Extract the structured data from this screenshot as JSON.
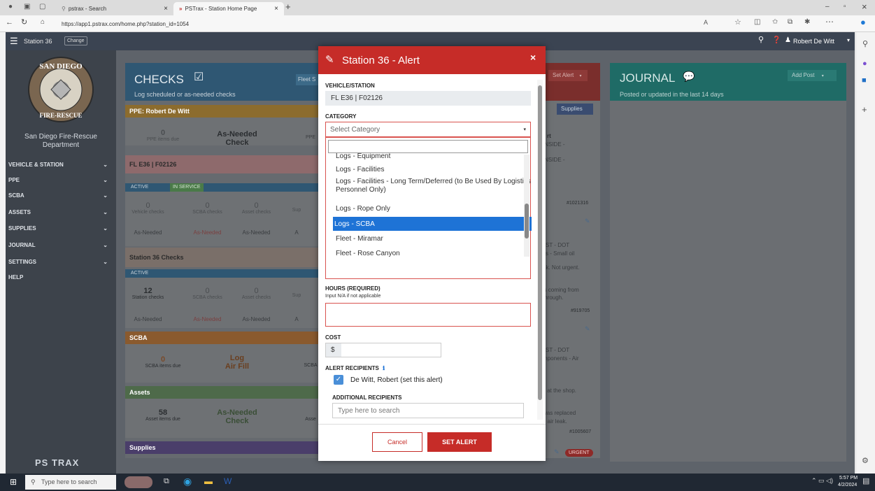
{
  "browser": {
    "tabs": [
      {
        "label": "pstrax - Search"
      },
      {
        "label": "PSTrax - Station Home Page"
      }
    ],
    "url": "https://app1.pstrax.com/home.php?station_id=1054",
    "close_glyph": "×",
    "newtab_glyph": "+"
  },
  "app": {
    "station": "Station 36",
    "change": "Change",
    "user": "Robert De Witt",
    "org_name": "San Diego Fire-Rescue Department",
    "brand": "PS TRAX",
    "seal_text_top": "SAN DIEGO",
    "seal_text_bottom": "FIRE-RESCUE",
    "sidebar": [
      {
        "label": "VEHICLE & STATION",
        "caret": "⌄"
      },
      {
        "label": "PPE",
        "caret": "⌄"
      },
      {
        "label": "SCBA",
        "caret": "⌄"
      },
      {
        "label": "ASSETS",
        "caret": "⌄"
      },
      {
        "label": "SUPPLIES",
        "caret": "⌄"
      },
      {
        "label": "JOURNAL",
        "caret": "⌄"
      },
      {
        "label": "SETTINGS",
        "caret": "⌄"
      },
      {
        "label": "HELP",
        "caret": ""
      }
    ]
  },
  "checks": {
    "title": "CHECKS",
    "subtitle": "Log scheduled or as-needed checks",
    "fleet_btn": "Fleet S",
    "ppe": {
      "header": "PPE: Robert De Witt",
      "count": "0",
      "count_label": "PPE items due",
      "action1": "As-Needed",
      "action2": "Check",
      "cut": "PPE"
    },
    "vehicle": {
      "header": "FL E36 | F02126",
      "badge_active": "ACTIVE",
      "badge_service": "IN SERVICE",
      "cols": [
        {
          "count": "0",
          "label": "Vehicle checks",
          "asneeded": "As-Needed"
        },
        {
          "count": "0",
          "label": "SCBA checks",
          "asneeded": "As-Needed"
        },
        {
          "count": "0",
          "label": "Asset checks",
          "asneeded": "As-Needed"
        },
        {
          "count": "",
          "label": "Sup",
          "asneeded": "A"
        }
      ]
    },
    "station": {
      "header": "Station 36 Checks",
      "badge_active": "ACTIVE",
      "cols": [
        {
          "count": "12",
          "label": "Station checks",
          "asneeded": "As-Needed"
        },
        {
          "count": "0",
          "label": "SCBA checks",
          "asneeded": "As-Needed"
        },
        {
          "count": "0",
          "label": "Asset checks",
          "asneeded": "As-Needed"
        },
        {
          "count": "",
          "label": "Sup",
          "asneeded": "A"
        }
      ]
    },
    "scba": {
      "header": "SCBA",
      "count": "0",
      "count_label": "SCBA items due",
      "action1": "Log",
      "action2": "Air Fill",
      "cut": "SCBA"
    },
    "assets": {
      "header": "Assets",
      "count": "58",
      "count_label": "Asset items due",
      "action1": "As-Needed",
      "action2": "Check",
      "cut": "Asse"
    },
    "supplies": {
      "header": "Supplies"
    }
  },
  "alerts": {
    "set_alert": "Set Alert",
    "supplies_tab": "Supplies",
    "items": [
      {
        "lines": [
          "rt",
          "INSIDE -"
        ],
        "id": ""
      },
      {
        "lines": [
          "INSIDE -"
        ],
        "id": "#1021316"
      },
      {
        "lines": [
          "JST - DOT",
          "ks - Small oil"
        ],
        "id": ""
      },
      {
        "lines": [
          "ak. Not urgent."
        ],
        "id": ""
      },
      {
        "lines": [
          "'s coming from",
          "through."
        ],
        "id": "#919705"
      },
      {
        "lines": [
          "JST - DOT",
          "mponents - Air"
        ],
        "id": ""
      },
      {
        "lines": [
          "k at the shop."
        ],
        "id": ""
      },
      {
        "lines": [
          "was replaced",
          "e air leak."
        ],
        "id": "#1005607"
      }
    ],
    "urgent": "URGENT"
  },
  "journal": {
    "title": "JOURNAL",
    "subtitle": "Posted or updated in the last 14 days",
    "add_post": "Add Post"
  },
  "modal": {
    "title": "Station 36 - Alert",
    "close": "×",
    "vehicle_label": "VEHICLE/STATION",
    "vehicle_value": "FL E36 | F02126",
    "category_label": "CATEGORY",
    "category_placeholder": "Select Category",
    "options": [
      "Logs - Equipment",
      "Logs - Facilities",
      "Logs - Facilities - Long Term/Deferred (to Be Used By Logistics Personnel Only)",
      "Logs - Rope Only",
      "Logs - SCBA",
      "Fleet - Miramar",
      "Fleet - Rose Canyon"
    ],
    "selected_index": 4,
    "hours_label": "HOURS (REQUIRED)",
    "hours_hint": "Input N/A if not applicable",
    "cost_label": "COST",
    "cost_prefix": "$",
    "recipients_label": "ALERT RECIPIENTS",
    "recipient_name": "De Witt, Robert (set this alert)",
    "additional_label": "ADDITIONAL RECIPIENTS",
    "search_placeholder": "Type here to search",
    "cancel": "Cancel",
    "submit": "SET ALERT"
  },
  "taskbar": {
    "search_placeholder": "Type here to search",
    "time": "5:57 PM",
    "date": "4/2/2024"
  },
  "colors": {
    "modal_header": "#c62c28",
    "selected_option": "#1e73d6",
    "sidebar": "#3d434b"
  }
}
